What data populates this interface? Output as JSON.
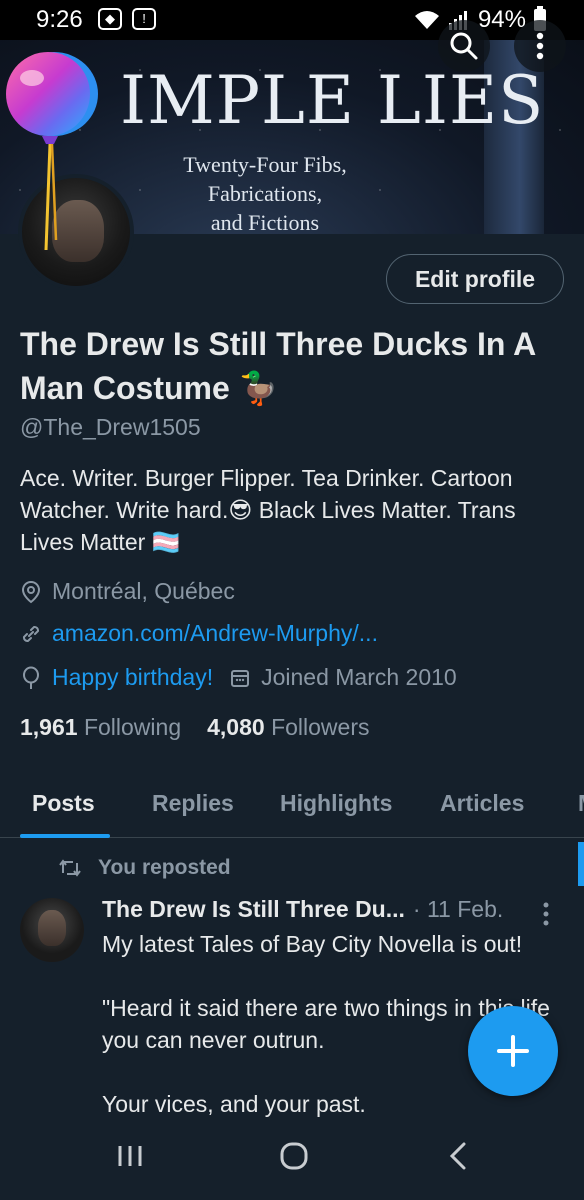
{
  "status_bar": {
    "time": "9:26",
    "battery": "94%"
  },
  "banner": {
    "title": "IMPLE LIES",
    "subtitle_lines": [
      "Twenty-Four Fibs,",
      "Fabrications,",
      "and Fictions"
    ]
  },
  "profile": {
    "edit_button": "Edit profile",
    "name": "The Drew Is Still Three Ducks In A Man Costume 🦆",
    "handle": "@The_Drew1505",
    "bio": "Ace. Writer. Burger Flipper. Tea Drinker. Cartoon Watcher. Write hard.😎  Black Lives Matter. Trans Lives Matter 🏳️‍⚧️",
    "location": "Montréal, Québec",
    "website": "amazon.com/Andrew-Murphy/...",
    "birthday": "Happy birthday!",
    "joined": "Joined March 2010",
    "following_count": "1,961",
    "following_label": "Following",
    "followers_count": "4,080",
    "followers_label": "Followers"
  },
  "tabs": [
    "Posts",
    "Replies",
    "Highlights",
    "Articles"
  ],
  "active_tab": "Posts",
  "post": {
    "repost_label": "You reposted",
    "author": "The Drew Is Still Three Du...",
    "date": "· 11 Feb.",
    "text": "My latest Tales of Bay City Novella is out!\n\n\"Heard it said there are two things in this life you can never outrun.\n\nYour vices, and your past."
  },
  "colors": {
    "accent": "#1d9bf0",
    "background": "#15202b",
    "muted": "#8b98a5"
  }
}
